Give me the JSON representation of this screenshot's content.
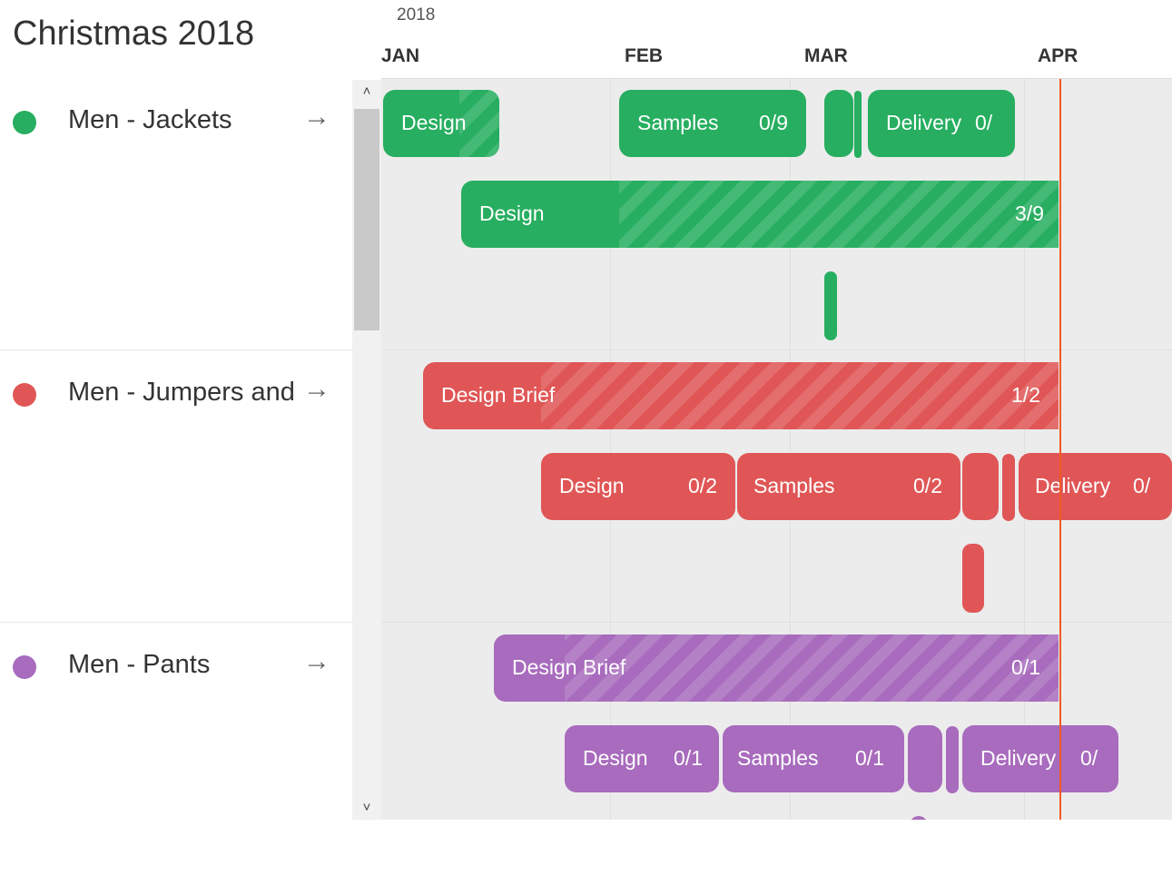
{
  "title": "Christmas 2018",
  "timeline": {
    "year": "2018",
    "months": [
      "JAN",
      "FEB",
      "MAR",
      "APR"
    ]
  },
  "projects": [
    {
      "name": "Men - Jackets",
      "color": "#27ae60",
      "arrow": "→"
    },
    {
      "name": "Men - Jumpers and Knitwear",
      "color": "#e05656",
      "arrow": "→"
    },
    {
      "name": "Men - Pants",
      "color": "#a86bbd",
      "arrow": "→"
    }
  ],
  "bars": {
    "jackets_design": {
      "label": "Design"
    },
    "jackets_samples": {
      "label": "Samples",
      "count": "0/9"
    },
    "jackets_delivery": {
      "label": "Delivery",
      "count": "0/"
    },
    "jackets_design2": {
      "label": "Design",
      "count": "3/9"
    },
    "jumpers_brief": {
      "label": "Design Brief",
      "count": "1/2"
    },
    "jumpers_design": {
      "label": "Design",
      "count": "0/2"
    },
    "jumpers_samples": {
      "label": "Samples",
      "count": "0/2"
    },
    "jumpers_delivery": {
      "label": "Delivery",
      "count": "0/"
    },
    "pants_brief": {
      "label": "Design Brief",
      "count": "0/1"
    },
    "pants_design": {
      "label": "Design",
      "count": "0/1"
    },
    "pants_samples": {
      "label": "Samples",
      "count": "0/1"
    },
    "pants_delivery": {
      "label": "Delivery",
      "count": "0/"
    }
  },
  "icons": {
    "scroll_up": "˄",
    "scroll_down": "˅"
  },
  "colors": {
    "today_line": "#f15a24",
    "grid_bg": "#ececec"
  }
}
